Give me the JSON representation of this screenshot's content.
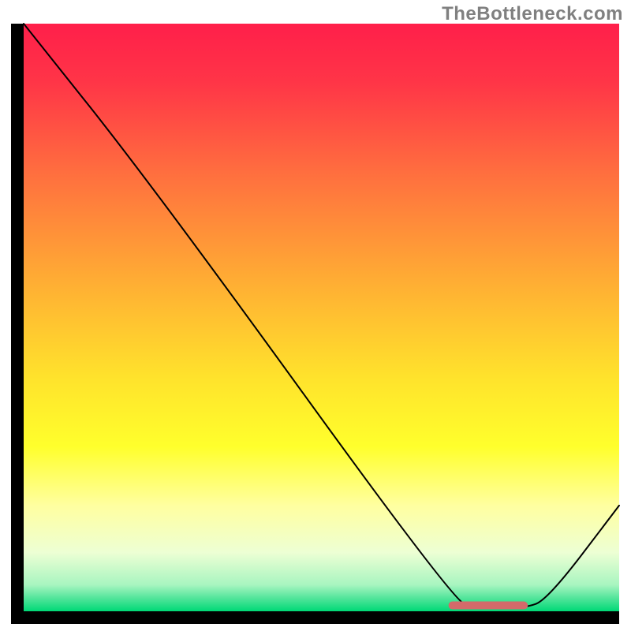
{
  "watermark": "TheBottleneck.com",
  "chart_data": {
    "type": "line",
    "title": "",
    "xlabel": "",
    "ylabel": "",
    "xlim": [
      0,
      100
    ],
    "ylim": [
      0,
      100
    ],
    "background_gradient": {
      "stops": [
        {
          "offset": 0.0,
          "color": "#ff1f4a"
        },
        {
          "offset": 0.1,
          "color": "#ff3547"
        },
        {
          "offset": 0.25,
          "color": "#ff6d3f"
        },
        {
          "offset": 0.45,
          "color": "#ffb133"
        },
        {
          "offset": 0.6,
          "color": "#ffe22c"
        },
        {
          "offset": 0.72,
          "color": "#ffff2c"
        },
        {
          "offset": 0.82,
          "color": "#ffffa0"
        },
        {
          "offset": 0.9,
          "color": "#edffd4"
        },
        {
          "offset": 0.955,
          "color": "#a8f5c0"
        },
        {
          "offset": 0.975,
          "color": "#5ce69f"
        },
        {
          "offset": 1.0,
          "color": "#00d976"
        }
      ]
    },
    "curve": {
      "points": [
        {
          "x": 0.0,
          "y": 100.0
        },
        {
          "x": 22.0,
          "y": 72.0
        },
        {
          "x": 72.0,
          "y": 2.0
        },
        {
          "x": 76.0,
          "y": 0.5
        },
        {
          "x": 84.0,
          "y": 0.5
        },
        {
          "x": 88.0,
          "y": 2.0
        },
        {
          "x": 100.0,
          "y": 18.0
        }
      ],
      "stroke": "#000000",
      "stroke_width": 2
    },
    "marker": {
      "x_start": 72.0,
      "x_end": 84.0,
      "y": 1.0,
      "color": "#d36a6a",
      "thickness": 10
    },
    "axes": {
      "left_border": true,
      "bottom_border": true,
      "border_color": "#000000",
      "border_width": 16
    }
  }
}
